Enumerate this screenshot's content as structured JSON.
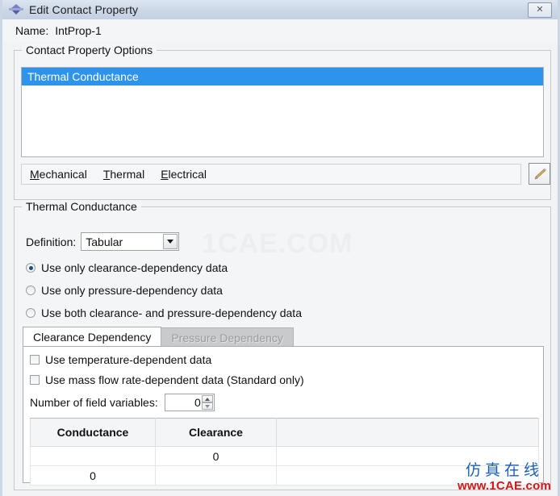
{
  "window": {
    "title": "Edit Contact Property",
    "icon": "abaqus-diamond-icon",
    "close_label": "✕"
  },
  "name_field": {
    "label": "Name:",
    "value": "IntProp-1"
  },
  "options_group": {
    "title": "Contact Property Options",
    "items": [
      {
        "label": "Thermal Conductance",
        "selected": true
      }
    ]
  },
  "category_menu": {
    "items": [
      {
        "mnemonic": "M",
        "rest": "echanical"
      },
      {
        "mnemonic": "T",
        "rest": "hermal"
      },
      {
        "mnemonic": "E",
        "rest": "lectrical"
      }
    ],
    "edit_button": "edit-pencil-button"
  },
  "thermal_group": {
    "title": "Thermal Conductance",
    "definition": {
      "label": "Definition:",
      "value": "Tabular",
      "options": [
        "Tabular"
      ]
    },
    "radios": [
      {
        "label": "Use only clearance-dependency data",
        "checked": true
      },
      {
        "label": "Use only pressure-dependency data",
        "checked": false
      },
      {
        "label": "Use both clearance- and pressure-dependency data",
        "checked": false
      }
    ],
    "dependency_tabs": [
      {
        "label": "Clearance Dependency",
        "active": true,
        "disabled": false
      },
      {
        "label": "Pressure Dependency",
        "active": false,
        "disabled": true
      }
    ],
    "checkboxes": [
      {
        "label": "Use temperature-dependent data",
        "checked": false
      },
      {
        "label": "Use mass flow rate-dependent data (Standard only)",
        "checked": false
      }
    ],
    "field_variables": {
      "label": "Number of field variables:",
      "value": "0"
    },
    "table": {
      "headers": [
        "Conductance",
        "Clearance"
      ],
      "rows": [
        {
          "conductance": "",
          "clearance": "0"
        },
        {
          "conductance": "0",
          "clearance": ""
        }
      ]
    }
  },
  "watermarks": {
    "center": "1CAE.COM",
    "bottom_right_cn": "仿真在线",
    "bottom_right_url": "www.1CAE.com"
  },
  "colors": {
    "selection_blue": "#2e93ea",
    "titlebar_top": "#dde5f0",
    "titlebar_bottom": "#c3d0e1",
    "watermark_red": "#d81414",
    "watermark_blue": "#1b5fb5"
  }
}
